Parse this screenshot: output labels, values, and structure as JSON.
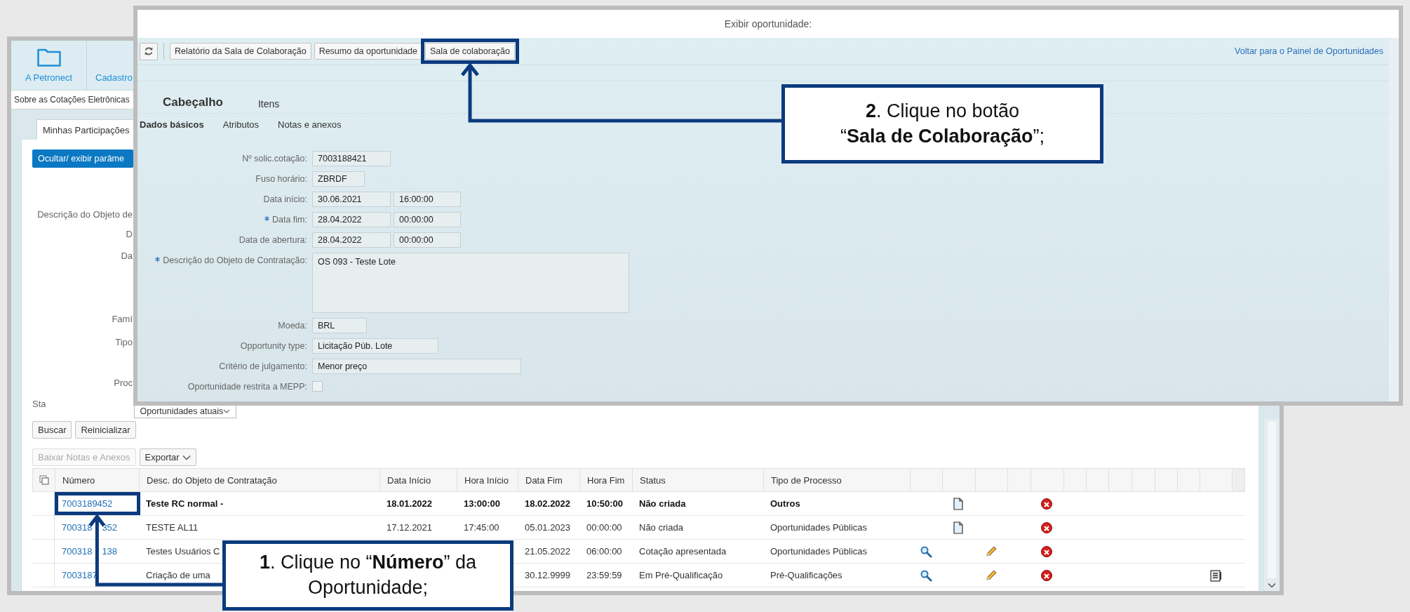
{
  "back_window": {
    "nav_tiles": [
      {
        "label": "A Petronect",
        "icon": true
      },
      {
        "label": "Cadastro",
        "icon": false
      }
    ],
    "breadcrumb": "Sobre as Cotações Eletrônicas",
    "tab": {
      "label": "Minhas Participações",
      "selected": true
    },
    "toggle_button": "Ocultar/ exibir parâme",
    "filter_labels": [
      "Descrição do Objeto de",
      "D",
      "Da",
      "Famí",
      "Tipo",
      "Proc",
      "Sta"
    ],
    "status_dropdown": {
      "value": "Oportunidades atuais"
    },
    "buttons": [
      "Buscar",
      "Reinicializar"
    ],
    "table_toolbar": [
      {
        "label": "Baixar Notas e Anexos",
        "disabled": true,
        "dropdown": false
      },
      {
        "label": "Exportar",
        "disabled": false,
        "dropdown": true
      }
    ],
    "table": {
      "columns": [
        "Número",
        "Desc. do Objeto de Contratação",
        "Data Início",
        "Hora Início",
        "Data Fim",
        "Hora Fim",
        "Status",
        "Tipo de Processo"
      ],
      "rows": [
        {
          "bold": true,
          "cells": [
            "7003189452",
            "Teste RC normal -",
            "18.01.2022",
            "13:00:00",
            "18.02.2022",
            "10:50:00",
            "Não criada",
            "Outros"
          ],
          "actions": {
            "view": false,
            "document": true,
            "edit": false,
            "cancel": true,
            "log": false
          }
        },
        {
          "bold": false,
          "cells": [
            [
              "700318",
              "352"
            ],
            "TESTE AL11",
            "17.12.2021",
            "17:45:00",
            "05.01.2023",
            "00:00:00",
            "Não criada",
            "Oportunidades Públicas"
          ],
          "actions": {
            "view": false,
            "document": true,
            "edit": false,
            "cancel": true,
            "log": false
          }
        },
        {
          "bold": false,
          "cells": [
            [
              "700318",
              "138"
            ],
            "Testes Usuários C",
            null,
            null,
            "21.05.2022",
            "06:00:00",
            "Cotação apresentada",
            "Oportunidades Públicas"
          ],
          "actions": {
            "view": true,
            "document": false,
            "edit": true,
            "cancel": true,
            "log": false
          }
        },
        {
          "bold": false,
          "cells": [
            [
              "7003187"
            ],
            "Criação de uma",
            null,
            null,
            "30.12.9999",
            "23:59:59",
            "Em Pré-Qualificação",
            "Pré-Qualificações"
          ],
          "actions": {
            "view": true,
            "document": false,
            "edit": true,
            "cancel": true,
            "log": true
          }
        }
      ]
    }
  },
  "front_window": {
    "title": "Exibir oportunidade:",
    "toolbar_buttons": [
      {
        "label": "Relatório da Sala de Colaboração"
      },
      {
        "label": "Resumo da oportunidade"
      },
      {
        "label": "Sala de colaboração"
      }
    ],
    "back_link": "Voltar para o Painel de Oportunidades",
    "section_tabs": [
      {
        "label": "Cabeçalho",
        "selected": true
      },
      {
        "label": "Itens",
        "selected": false
      }
    ],
    "subtabs": [
      {
        "label": "Dados básicos",
        "selected": true
      },
      {
        "label": "Atributos",
        "selected": false
      },
      {
        "label": "Notas e anexos",
        "selected": false
      }
    ],
    "fields": [
      {
        "kind": "text",
        "label": "Nº solic.cotação:",
        "required": false,
        "values": [
          "7003188421"
        ]
      },
      {
        "kind": "text",
        "label": "Fuso horário:",
        "required": false,
        "values": [
          "ZBRDF"
        ]
      },
      {
        "kind": "text",
        "label": "Data início:",
        "required": false,
        "values": [
          "30.06.2021",
          "16:00:00"
        ]
      },
      {
        "kind": "text",
        "label": "Data fim:",
        "required": true,
        "values": [
          "28.04.2022",
          "00:00:00"
        ]
      },
      {
        "kind": "text",
        "label": "Data de abertura:",
        "required": false,
        "values": [
          "28.04.2022",
          "00:00:00"
        ]
      },
      {
        "kind": "textarea",
        "label": "Descrição do Objeto de Contratação:",
        "required": true,
        "values": [
          "OS 093 - Teste Lote"
        ]
      },
      {
        "kind": "text",
        "label": "Moeda:",
        "required": false,
        "values": [
          "BRL"
        ]
      },
      {
        "kind": "text",
        "label": "Opportunity type:",
        "required": false,
        "values": [
          "Licitação Púb. Lote"
        ]
      },
      {
        "kind": "text",
        "label": "Critério de julgamento:",
        "required": false,
        "values": [
          "Menor preço"
        ]
      },
      {
        "kind": "checkbox",
        "label": "Oportunidade restrita a MEPP:",
        "required": false,
        "checked": false
      }
    ]
  },
  "callouts": [
    {
      "text": "**1**. Clique no “**Número**” da\nOportunidade;"
    },
    {
      "text": "**2**. Clique no botão\n“**Sala de Colaboração**”;"
    }
  ]
}
